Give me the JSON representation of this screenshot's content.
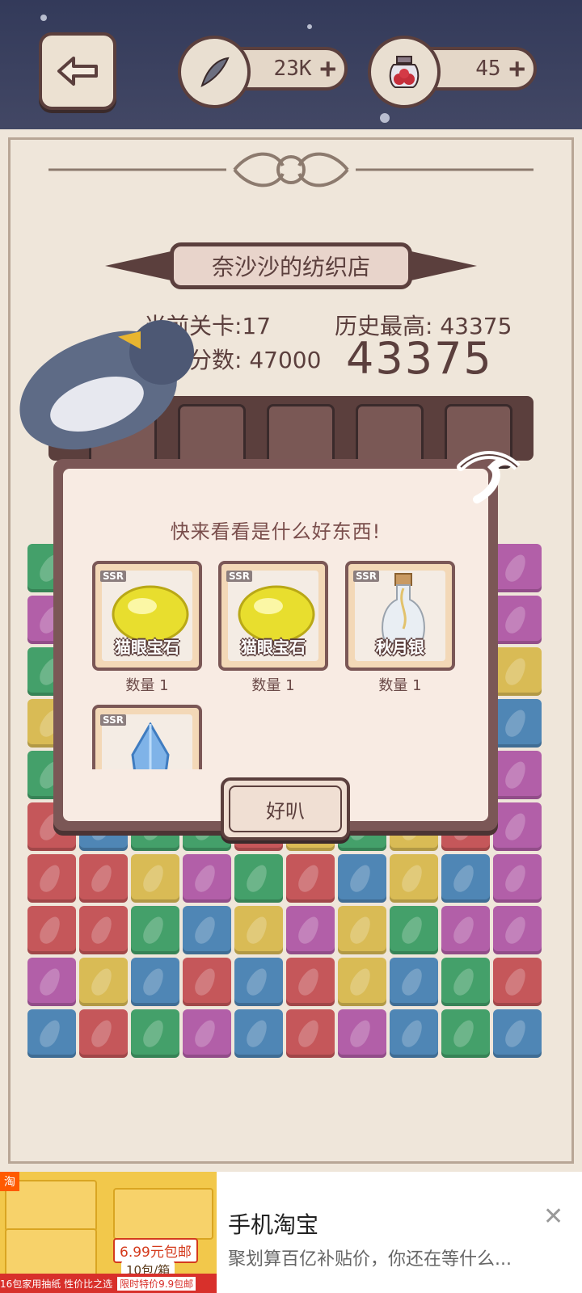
{
  "header": {
    "back_label": "←",
    "feather_currency": "23K",
    "potion_currency": "45",
    "plus_label": "+"
  },
  "level": {
    "shop_title": "奈沙沙的纺织店",
    "current_level_label": "当前关卡:17",
    "high_score_label": "历史最高: 43375",
    "target_score_label": "目标分数: 47000",
    "current_score": "43375"
  },
  "reward_dialog": {
    "title": "快来看看是什么好东西!",
    "rarity_tag": "SSR",
    "items": [
      {
        "name": "猫眼宝石",
        "quantity": "数量 1",
        "icon": "yellow-gem-icon"
      },
      {
        "name": "猫眼宝石",
        "quantity": "数量 1",
        "icon": "yellow-gem-icon"
      },
      {
        "name": "秋月银",
        "quantity": "数量 1",
        "icon": "silver-bottle-icon"
      },
      {
        "name": "",
        "quantity": "",
        "icon": "blue-crystal-icon"
      }
    ],
    "ok_label": "好叭"
  },
  "ad": {
    "title": "手机淘宝",
    "description": "聚划算百亿补贴价，你还在等什么...",
    "price_tag": "6.99元包邮",
    "pack_count": "10包/箱",
    "bottom_left": "16包家用抽纸 性价比之选",
    "bottom_right": "限时特价9.9包邮",
    "logo": "淘",
    "close_label": "✕"
  },
  "colors": {
    "tile_red": "#c5575a",
    "tile_blue": "#4f86b5",
    "tile_green": "#44a06a",
    "tile_yellow": "#d9bb55",
    "tile_purple": "#b25fa8",
    "frame_brown": "#5b3f3d"
  }
}
